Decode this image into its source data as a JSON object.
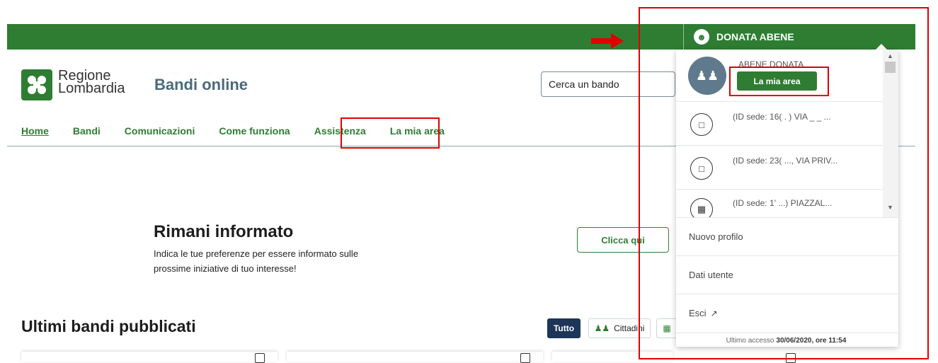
{
  "header": {
    "user_name": "DONATA ABENE",
    "site_title": "Bandi online",
    "logo_line1": "Regione",
    "logo_line2": "Lombardia",
    "search_placeholder": "Cerca un bando"
  },
  "nav": {
    "items": [
      "Home",
      "Bandi",
      "Comunicazioni",
      "Come funziona",
      "Assistenza",
      "La mia area"
    ]
  },
  "info": {
    "title": "Rimani informato",
    "text": "Indica le tue preferenze per essere informato sulle prossime iniziative di tuo interesse!",
    "button": "Clicca qui"
  },
  "bandi": {
    "title": "Ultimi bandi pubblicati",
    "filters": [
      "Tutto",
      "Cittadini"
    ]
  },
  "dropdown": {
    "profile_name": "ABENE DONATA",
    "mia_area_button": "La mia area",
    "sedi": [
      {
        "text": "(ID sede: 16( . ) VIA _ _ ...",
        "icon": "building-icon"
      },
      {
        "text": "(ID sede: 23( ..., VIA PRIV...",
        "icon": "building-icon"
      },
      {
        "text": "(ID sede: 1' ...) PIAZZAL...",
        "icon": "factory-icon"
      }
    ],
    "menu": [
      "Nuovo profilo",
      "Dati utente",
      "Esci"
    ],
    "last_access_label": "Ultimo accesso",
    "last_access_date": "30/06/2020, ore 11:54"
  },
  "colors": {
    "brand_green": "#2e7d32",
    "highlight_red": "#e00000",
    "navy": "#1d3557"
  }
}
